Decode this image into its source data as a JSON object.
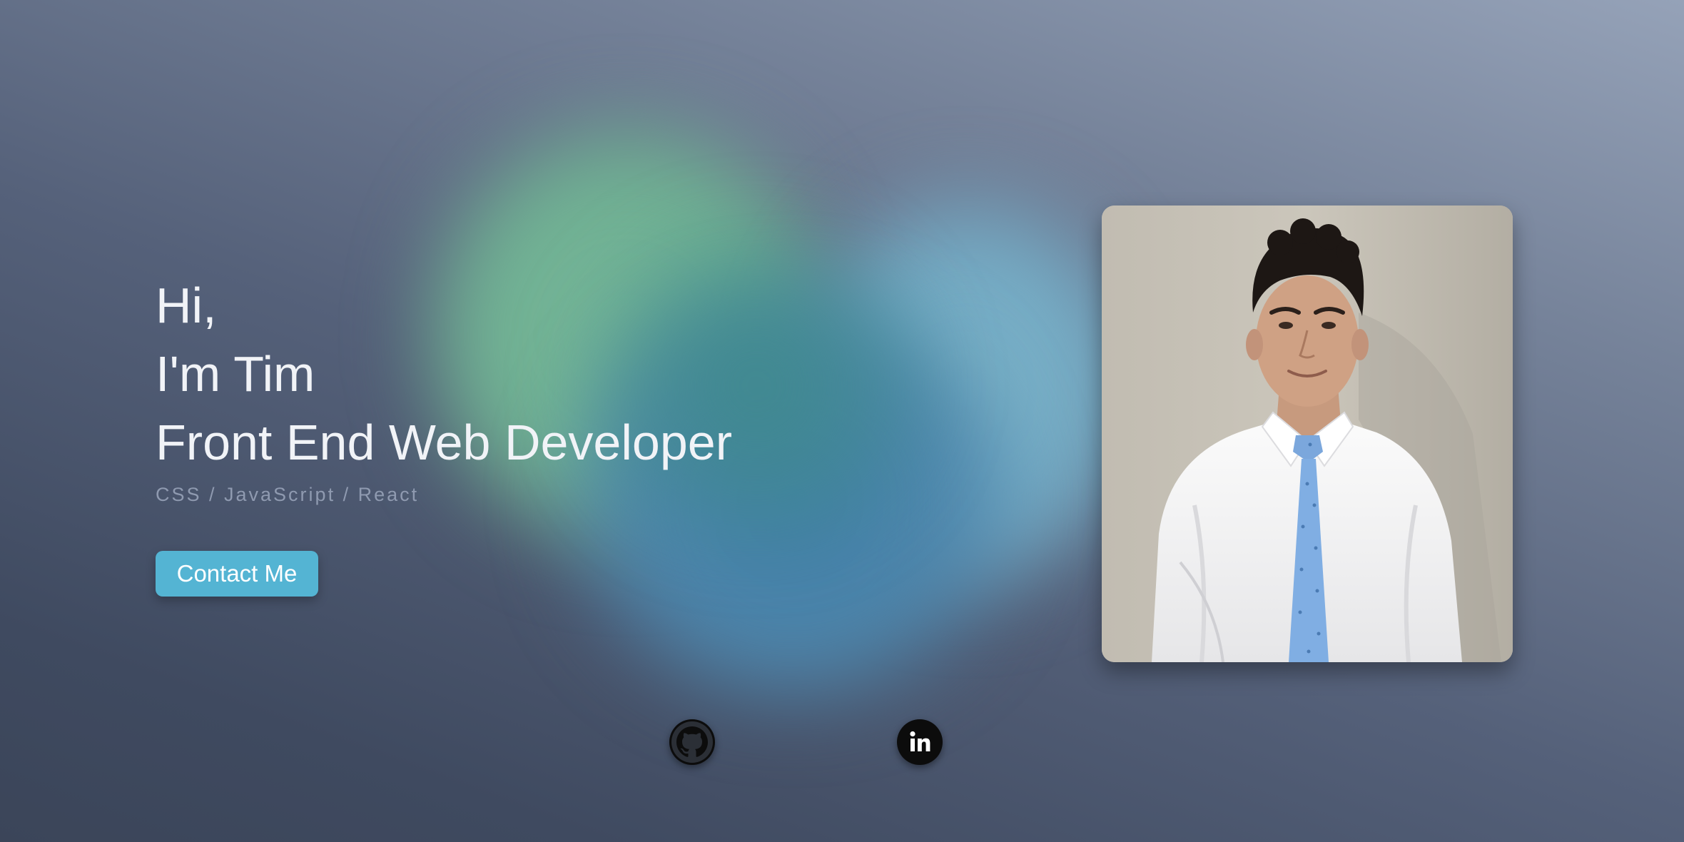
{
  "hero": {
    "greeting": "Hi,",
    "intro": "I'm Tim",
    "role": "Front End Web Developer",
    "stack": "CSS / JavaScript / React"
  },
  "contact_button": {
    "label": "Contact Me"
  },
  "social": {
    "github_icon": "github-icon",
    "linkedin_icon": "linkedin-icon"
  },
  "colors": {
    "accent_button": "#54b4d3",
    "background_dark": "#3f4a60",
    "background_light": "#95a2b8",
    "text_primary": "#f1f3f7",
    "text_muted": "#8f9ab0"
  }
}
